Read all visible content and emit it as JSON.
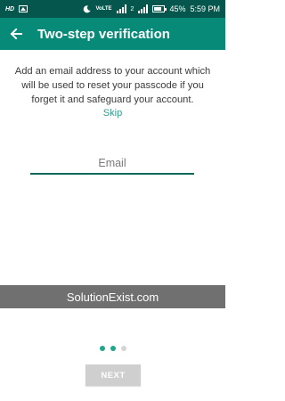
{
  "status_bar": {
    "left_icons": [
      "hd-icon",
      "gallery-icon"
    ],
    "right_icons": [
      "moon-icon",
      "volte-icon",
      "signal-icon",
      "signal2-icon",
      "battery-icon"
    ],
    "volte_text": "VoLTE",
    "network_2": "2",
    "battery_percent": "45%",
    "time": "5:59 PM"
  },
  "app_bar": {
    "title": "Two-step verification",
    "back_icon": "arrow-left-icon"
  },
  "main": {
    "description": "Add an email address to your account which will be used to reset your passcode if you forget it and safeguard your account.",
    "skip_label": "Skip",
    "email_placeholder": "Email",
    "email_value": ""
  },
  "watermark": {
    "text": "SolutionExist.com"
  },
  "pager": {
    "total": 3,
    "active": [
      0,
      1
    ],
    "active_color": "#21a68c",
    "inactive_color": "#d5d5d5"
  },
  "footer": {
    "next_label": "NEXT"
  },
  "colors": {
    "status_bar": "#05574d",
    "app_bar": "#078a77",
    "accent": "#2a9d8f",
    "button_disabled": "#cfcfcf"
  }
}
